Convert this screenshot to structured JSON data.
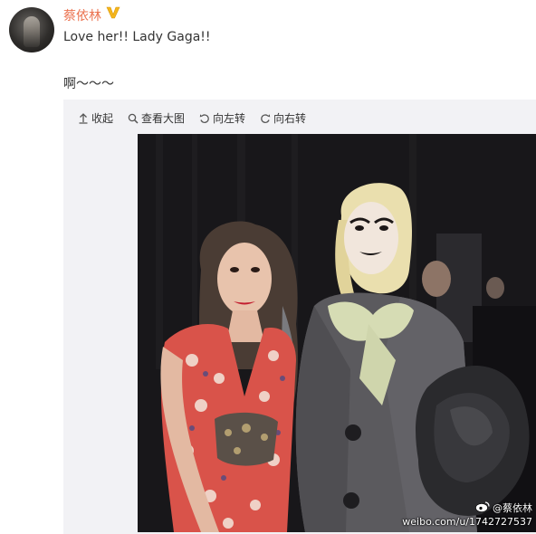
{
  "post": {
    "username": "蔡依林",
    "text_line1": "Love her!! Lady Gaga!!",
    "text_line2": "啊～～～"
  },
  "toolbar": {
    "collapse": "收起",
    "view_large": "查看大图",
    "rotate_left": "向左转",
    "rotate_right": "向右转"
  },
  "watermark": {
    "handle": "@蔡依林",
    "url": "weibo.com/u/1742727537"
  },
  "colors": {
    "username": "#eb7350",
    "verified_badge": "#f5b61b",
    "media_bg": "#f2f2f5"
  },
  "icons": {
    "verified": "verified-v-icon",
    "collapse": "arrow-up-icon",
    "view_large": "magnifier-icon",
    "rotate_left": "rotate-left-icon",
    "rotate_right": "rotate-right-icon",
    "weibo": "weibo-logo-icon"
  }
}
